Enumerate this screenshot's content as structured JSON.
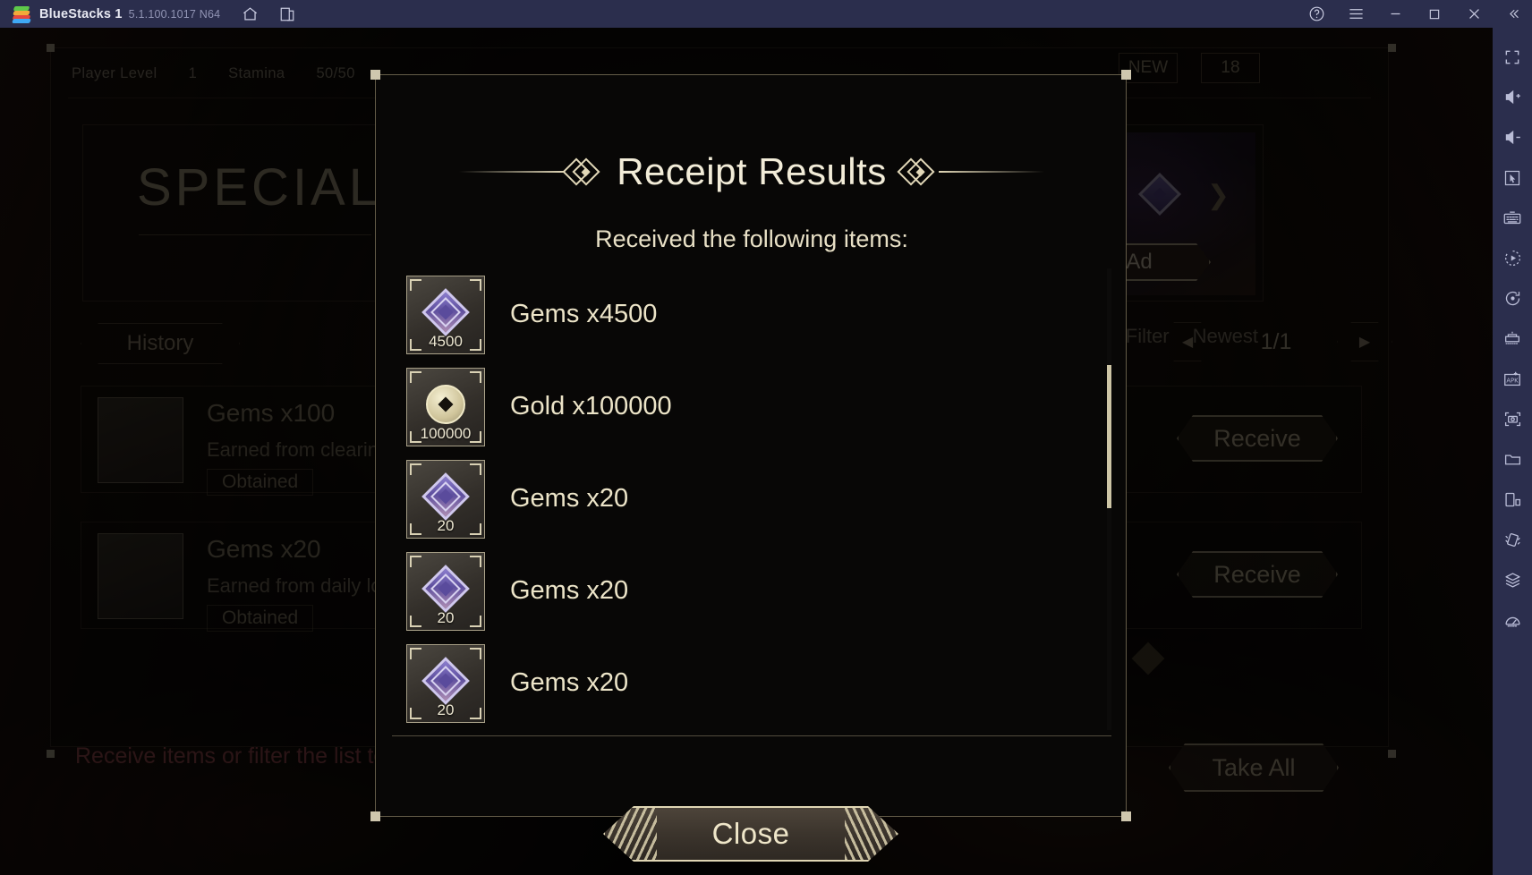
{
  "titlebar": {
    "app_name": "BlueStacks 1",
    "version": "5.1.100.1017 N64",
    "icons": [
      "home-icon",
      "multi-instance-icon"
    ],
    "controls": [
      "help-icon",
      "menu-icon",
      "minimize-icon",
      "maximize-icon",
      "close-icon",
      "collapse-icon"
    ]
  },
  "sidebar": {
    "items": [
      {
        "name": "fullscreen-icon"
      },
      {
        "name": "volume-up-icon"
      },
      {
        "name": "volume-down-icon"
      },
      {
        "name": "cursor-icon"
      },
      {
        "name": "keyboard-controls-icon"
      },
      {
        "name": "macro-record-icon"
      },
      {
        "name": "rotate-icon"
      },
      {
        "name": "game-controls-icon"
      },
      {
        "name": "install-apk-icon"
      },
      {
        "name": "screenshot-icon"
      },
      {
        "name": "media-folder-icon"
      },
      {
        "name": "screen-share-icon"
      },
      {
        "name": "shake-icon"
      },
      {
        "name": "multi-layer-icon"
      },
      {
        "name": "performance-gauge-icon"
      }
    ]
  },
  "game_background": {
    "status_bar": [
      "Player Level",
      "1",
      "Stamina",
      "50/50"
    ],
    "special_banner_title": "SPECIAL",
    "watch_video_label": "Watch Video Ad",
    "history_label": "History",
    "filter_label": "Filter",
    "filter_value": "Newest",
    "page_indicator": "1/1",
    "new_badge": "NEW",
    "count_badge": "18",
    "warning_text": "Receive items or filter the list to see more",
    "take_all_label": "Take All",
    "mail_rows": [
      {
        "title": "Gems x100",
        "subtitle": "Earned from clearing stage",
        "status": "Obtained",
        "qty": "100",
        "action_label": "Receive"
      },
      {
        "title": "Gems x20",
        "subtitle": "Earned from daily login promotion",
        "status": "Obtained",
        "qty": "20",
        "action_label": "Receive"
      }
    ]
  },
  "modal": {
    "title": "Receipt Results",
    "subtitle": "Received the following items:",
    "close_label": "Close",
    "items": [
      {
        "icon": "gem-icon",
        "qty": "4500",
        "label": "Gems x4500"
      },
      {
        "icon": "gold-icon",
        "qty": "100000",
        "label": "Gold x100000"
      },
      {
        "icon": "gem-icon",
        "qty": "20",
        "label": "Gems x20"
      },
      {
        "icon": "gem-icon",
        "qty": "20",
        "label": "Gems x20"
      },
      {
        "icon": "gem-icon",
        "qty": "20",
        "label": "Gems x20"
      }
    ]
  },
  "colors": {
    "titlebar_bg": "#2b2e4d",
    "gold_accent": "#e2d8b8",
    "text_cream": "#ece4c8",
    "warning_red": "#b2555c",
    "gem_purple": "#5e4f9e"
  }
}
